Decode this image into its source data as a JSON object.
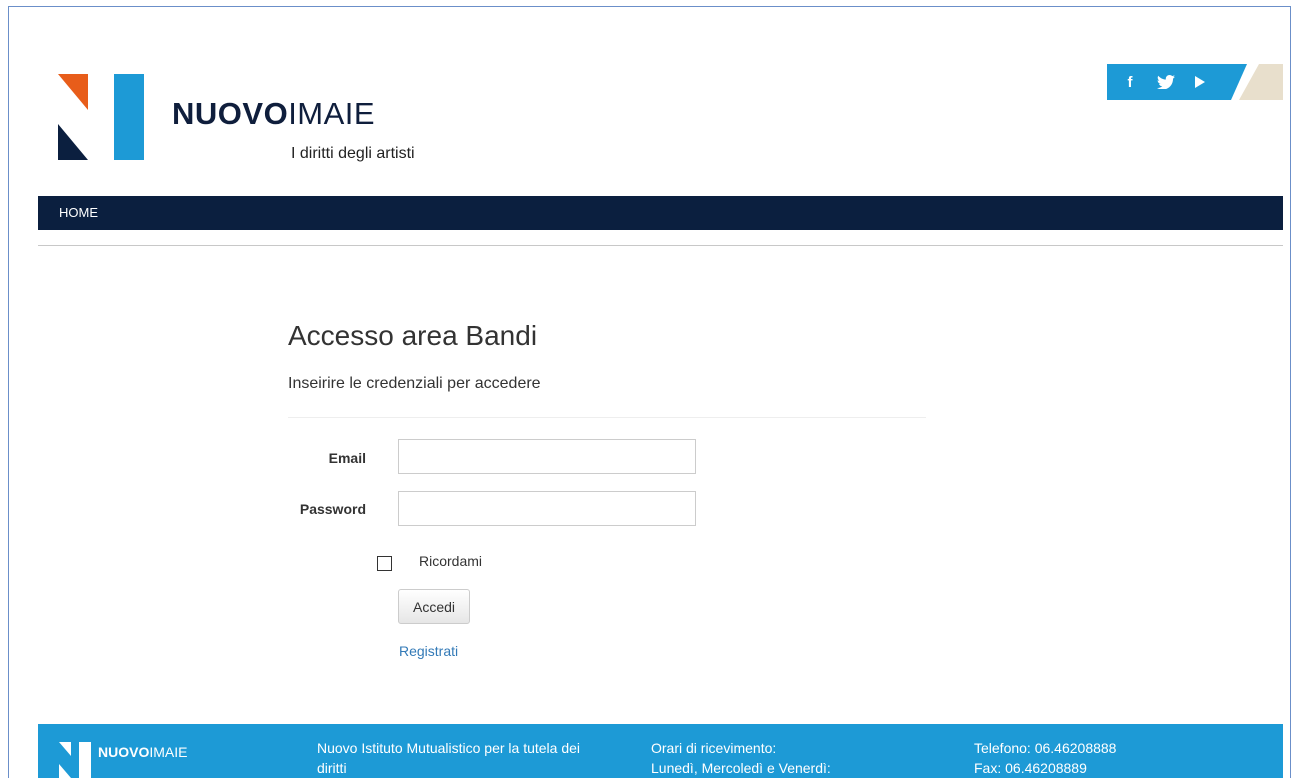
{
  "header": {
    "brand_bold": "NUOVO",
    "brand_light": "IMAIE",
    "tagline": "I diritti degli artisti"
  },
  "social": {
    "facebook": "f",
    "twitter_icon": "twitter-icon",
    "youtube_icon": "play-icon"
  },
  "nav": {
    "items": [
      {
        "label": "HOME"
      }
    ]
  },
  "login": {
    "title": "Accesso area Bandi",
    "subtitle": "Inseirire le credenziali per accedere",
    "email_label": "Email",
    "email_value": "",
    "password_label": "Password",
    "password_value": "",
    "remember_label": "Ricordami",
    "submit_label": "Accedi",
    "register_label": "Registrati"
  },
  "footer": {
    "brand_bold": "NUOVO",
    "brand_light": "IMAIE",
    "col1": [
      "Nuovo Istituto Mutualistico per la tutela dei",
      "diritti"
    ],
    "col2": [
      "Orari di ricevimento:",
      "Lunedì, Mercoledì e Venerdì:"
    ],
    "col3": [
      "Telefono: 06.46208888",
      "Fax: 06.46208889"
    ]
  },
  "colors": {
    "navy": "#0b1f3f",
    "cyan": "#1d9ad6",
    "orange": "#e85d1a",
    "link": "#337ab7",
    "beige": "#e8dfcc"
  }
}
